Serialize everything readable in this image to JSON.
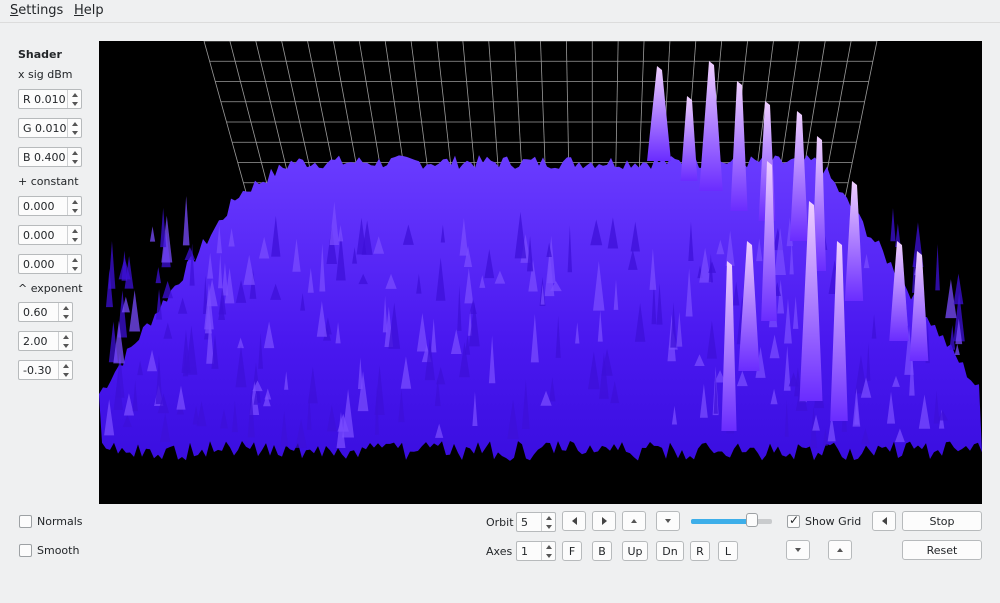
{
  "menu": {
    "settings": "Settings",
    "help": "Help"
  },
  "sidebar": {
    "title": "Shader",
    "sig_label": "x sig dBm",
    "sig_fields": [
      "R 0.010",
      "G 0.010",
      "B 0.400"
    ],
    "constant_label": "+ constant",
    "constant_fields": [
      "0.000",
      "0.000",
      "0.000"
    ],
    "exponent_label": "^ exponent",
    "exponent_fields": [
      "0.60",
      "2.00",
      "-0.30"
    ]
  },
  "options": {
    "normals": "Normals",
    "smooth": "Smooth"
  },
  "controls": {
    "orbit_label": "Orbit",
    "orbit_value": "5",
    "axes_label": "Axes",
    "axes_value": "1",
    "axes_buttons": [
      "F",
      "B",
      "Up",
      "Dn",
      "R",
      "L"
    ],
    "slider_level": 0.75,
    "show_grid": "Show Grid",
    "show_grid_checked": true,
    "stop": "Stop",
    "reset": "Reset"
  },
  "colors": {
    "surface": "#5a1fff",
    "peak": "#e2b6ff",
    "grid": "#9a9a9a",
    "background": "#000000"
  }
}
